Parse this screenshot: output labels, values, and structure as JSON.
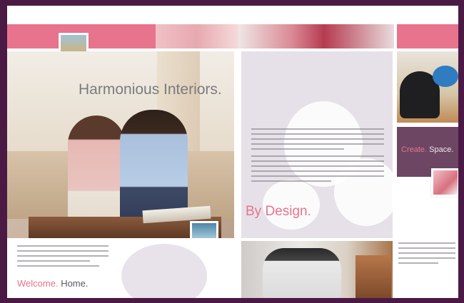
{
  "spread": {
    "headline": "Harmonious Interiors.",
    "by_design": "By Design.",
    "create_word": "Create.",
    "space_word": "Space.",
    "welcome_word": "Welcome.",
    "home_word": "Home."
  },
  "colors": {
    "background": "#4a1a44",
    "accent_pink": "#e8738d",
    "lilac": "#e6e1e8",
    "plum": "#6c4663",
    "text_gray": "#7b7b80"
  }
}
